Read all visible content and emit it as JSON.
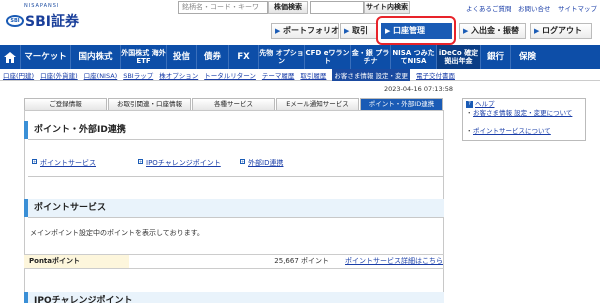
{
  "header": {
    "logo_small": "NISAPANSI",
    "logo_mark": "SBI",
    "logo_name": "SBI証券",
    "search_placeholder": "銘柄名・コード・キーワ",
    "search_button": "株価検索",
    "site_search_button": "サイト内検索",
    "links": [
      "よくあるご質問",
      "お問い合せ",
      "サイトマップ"
    ]
  },
  "menu": {
    "portfolio": "ポートフォリオ",
    "trade": "取引",
    "account": "口座管理",
    "deposit": "入出金・振替",
    "logout": "ログアウト"
  },
  "nav": [
    {
      "label": "マーケット"
    },
    {
      "label": "国内株式"
    },
    {
      "label": "外国株式 海外ETF"
    },
    {
      "label": "投信"
    },
    {
      "label": "債券"
    },
    {
      "label": "FX"
    },
    {
      "label": "先物 オプション"
    },
    {
      "label": "CFD eワラント"
    },
    {
      "label": "金・銀 プラチナ"
    },
    {
      "label": "NISA つみたてNISA"
    },
    {
      "label": "iDeCo 確定拠出年金"
    },
    {
      "label": "銀行"
    },
    {
      "label": "保険"
    }
  ],
  "subnav": [
    "口座(円建)",
    "口座(外貨建)",
    "口座(NISA)",
    "SBIラップ",
    "株オプション",
    "トータルリターン",
    "テーマ履歴",
    "取引履歴",
    "お客さま情報 設定・変更",
    "電子交付書面"
  ],
  "timestamp": "2023-04-16 07:13:58",
  "tabs": [
    "ご登録情報",
    "お取引関連・口座情報",
    "各種サービス",
    "Eメール通知サービス",
    "ポイント・外部ID連携"
  ],
  "page_title": "ポイント・外部ID連携",
  "anchor_links": [
    "ポイントサービス",
    "IPOチャレンジポイント",
    "外部ID連携"
  ],
  "section_points": {
    "title": "ポイントサービス",
    "message": "メインポイント設定中のポイントを表示しております。",
    "row_label": "Pontaポイント",
    "row_value": "25,667 ポイント",
    "row_link": "ポイントサービス詳細はこちら"
  },
  "section_ipo": {
    "title": "IPOチャレンジポイント"
  },
  "sidebar": {
    "help_label": "ヘルプ",
    "items": [
      "お客さま情報 設定・変更について",
      "ポイントサービスについて"
    ]
  },
  "colors": {
    "brand_blue": "#0d4ea8",
    "highlight_red": "#e8232a",
    "accent_light": "#3a8fd6"
  }
}
